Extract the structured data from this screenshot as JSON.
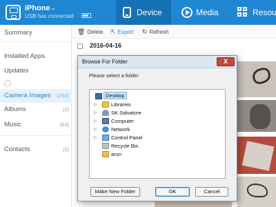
{
  "device": {
    "name": "iPhone",
    "status": "USB has connected"
  },
  "tabs": [
    {
      "label": "Device",
      "icon": "device-icon",
      "active": true
    },
    {
      "label": "Media",
      "icon": "media-play-icon",
      "active": false
    },
    {
      "label": "Resour",
      "icon": "resources-grid-icon",
      "active": false
    }
  ],
  "sidebar": {
    "items": [
      {
        "label": "Summary",
        "count": ""
      },
      {
        "label": "Installed Apps",
        "count": ""
      },
      {
        "label": "Updates",
        "count": ""
      },
      {
        "label": "Camera Images",
        "count": "(234)"
      },
      {
        "label": "Albums",
        "count": "(2)"
      },
      {
        "label": "Music",
        "count": "(63)"
      },
      {
        "label": "Contacts",
        "count": "(1)"
      }
    ]
  },
  "toolbar": {
    "delete_label": "Delete",
    "export_label": "Export",
    "refresh_label": "Refresh"
  },
  "content": {
    "date_label": "2016-04-16"
  },
  "dialog": {
    "title": "Browse For Folder",
    "close_label": "X",
    "prompt": "Please select a folder",
    "tree": [
      {
        "label": "Desktop",
        "icon": "desktop-icon",
        "selected": true
      },
      {
        "label": "Libraries",
        "icon": "folder-icon",
        "selected": false
      },
      {
        "label": "SK Salvatore",
        "icon": "user-folder-icon",
        "selected": false
      },
      {
        "label": "Computer",
        "icon": "computer-icon",
        "selected": false
      },
      {
        "label": "Network",
        "icon": "network-icon",
        "selected": false
      },
      {
        "label": "Control Panel",
        "icon": "control-panel-icon",
        "selected": false
      },
      {
        "label": "Recycle Bin",
        "icon": "recycle-bin-icon",
        "selected": false
      },
      {
        "label": "arun",
        "icon": "folder-icon",
        "selected": false
      }
    ],
    "new_folder_label": "Make New Folder",
    "ok_label": "OK",
    "cancel_label": "Cancel"
  },
  "colors": {
    "header_blue": "#1f86d3",
    "active_tab": "#1670b4",
    "active_sidebar_bg": "#e6f1fb",
    "accent": "#1f86d3"
  }
}
